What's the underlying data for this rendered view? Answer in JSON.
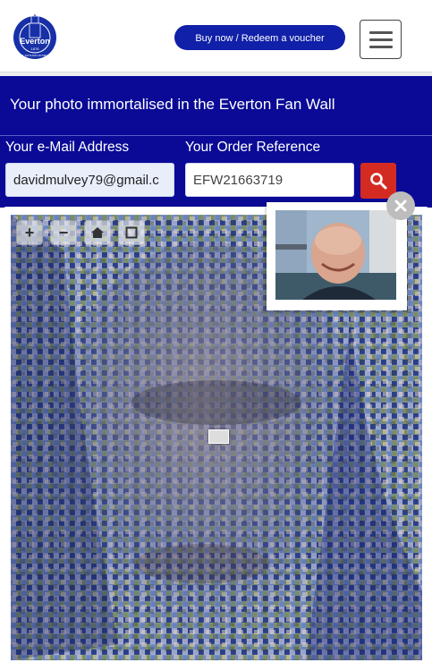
{
  "header": {
    "crest": {
      "name": "Everton",
      "year": "1878",
      "motto": "NIL SATIS NISI OPTIMUM"
    },
    "voucher_button": "Buy now / Redeem a voucher"
  },
  "banner": {
    "title": "Your photo immortalised in the Everton Fan Wall"
  },
  "form": {
    "email_label": "Your e-Mail Address",
    "email_value": "davidmulvey79@gmail.c",
    "order_label": "Your Order Reference",
    "order_value": "EFW21663719"
  },
  "icons": {
    "menu": "hamburger-icon",
    "search": "search-icon",
    "zoom_in": "plus-icon",
    "zoom_out": "minus-icon",
    "home": "home-icon",
    "fullscreen": "fullscreen-icon",
    "close": "close-icon"
  },
  "colors": {
    "brand_blue": "#0a0a96",
    "button_blue": "#1020a8",
    "search_red": "#d32b22"
  }
}
